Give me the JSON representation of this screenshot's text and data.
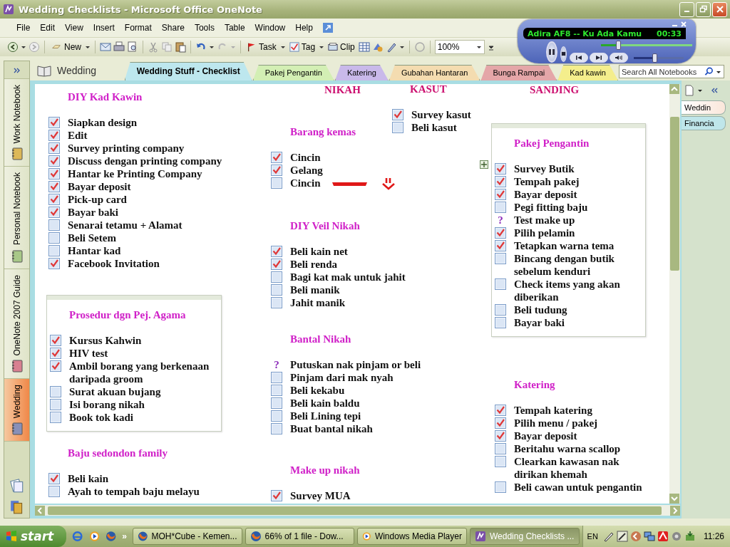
{
  "window": {
    "title": "Wedding Checklists - Microsoft Office OneNote"
  },
  "menu": [
    "File",
    "Edit",
    "View",
    "Insert",
    "Format",
    "Share",
    "Tools",
    "Table",
    "Window",
    "Help"
  ],
  "toolbar": {
    "new": "New",
    "task": "Task",
    "tag": "Tag",
    "clip": "Clip",
    "zoom": "100%"
  },
  "notebooks": [
    {
      "name": "Work Notebook",
      "color": "#dcb858",
      "selected": false
    },
    {
      "name": "Personal Notebook",
      "color": "#a8c888",
      "selected": false
    },
    {
      "name": "OneNote 2007 Guide",
      "color": "#d88090",
      "selected": false
    },
    {
      "name": "Wedding",
      "color": "#8890b8",
      "selected": true
    }
  ],
  "notebook_title": "Wedding",
  "sections": [
    {
      "label": "Wedding Stuff - Checklist",
      "color": "#bde7ee",
      "selected": true
    },
    {
      "label": "Pakej Pengantin",
      "color": "#d3efb4",
      "selected": false
    },
    {
      "label": "Katering",
      "color": "#c9b9ea",
      "selected": false
    },
    {
      "label": "Gubahan Hantaran",
      "color": "#f4dcb0",
      "selected": false
    },
    {
      "label": "Bunga Rampai",
      "color": "#e4a6a8",
      "selected": false
    },
    {
      "label": "Kad kawin",
      "color": "#f4ee8c",
      "selected": false
    }
  ],
  "search": {
    "placeholder": "Search All Notebooks"
  },
  "pages": [
    {
      "label": "Weddin",
      "selected": true
    },
    {
      "label": "Financia",
      "selected": false
    }
  ],
  "headings": [
    "NIKAH",
    "KASUT",
    "SANDING"
  ],
  "outlines": [
    {
      "title": "DIY Kad Kawin",
      "boxed": false,
      "items": [
        {
          "kind": "check",
          "text": "Siapkan design",
          "checked": true
        },
        {
          "kind": "check",
          "text": "Edit",
          "checked": true
        },
        {
          "kind": "check",
          "text": "Survey printing company",
          "checked": true
        },
        {
          "kind": "check",
          "text": "Discuss dengan printing company",
          "checked": true
        },
        {
          "kind": "check",
          "text": "Hantar ke Printing Company",
          "checked": true
        },
        {
          "kind": "check",
          "text": "Bayar deposit",
          "checked": true
        },
        {
          "kind": "check",
          "text": "Pick-up card",
          "checked": true
        },
        {
          "kind": "check",
          "text": "Bayar baki",
          "checked": true
        },
        {
          "kind": "check",
          "text": "Senarai tetamu + Alamat",
          "checked": false
        },
        {
          "kind": "check",
          "text": "Beli Setem",
          "checked": false
        },
        {
          "kind": "check",
          "text": "Hantar kad",
          "checked": false
        },
        {
          "kind": "check",
          "text": "Facebook Invitation",
          "checked": true
        }
      ]
    },
    {
      "title": "Prosedur dgn Pej. Agama",
      "boxed": true,
      "items": [
        {
          "kind": "check",
          "text": "Kursus Kahwin",
          "checked": true
        },
        {
          "kind": "check",
          "text": "HIV test",
          "checked": true
        },
        {
          "kind": "check",
          "text": "Ambil borang yang berkenaan daripada groom",
          "checked": true
        },
        {
          "kind": "check",
          "text": "Surat akuan bujang",
          "checked": false
        },
        {
          "kind": "check",
          "text": "Isi borang nikah",
          "checked": false
        },
        {
          "kind": "check",
          "text": "Book tok kadi",
          "checked": false
        }
      ]
    },
    {
      "title": "Baju sedondon family",
      "boxed": false,
      "items": [
        {
          "kind": "check",
          "text": "Beli kain",
          "checked": true
        },
        {
          "kind": "check",
          "text": "Ayah to tempah baju melayu",
          "checked": false
        }
      ]
    },
    {
      "title": "Barang kemas",
      "boxed": false,
      "items": [
        {
          "kind": "check",
          "text": "Cincin",
          "checked": true
        },
        {
          "kind": "check",
          "text": "Gelang",
          "checked": true
        },
        {
          "kind": "check",
          "text": "Cincin",
          "checked": false,
          "redacted": true
        }
      ]
    },
    {
      "title": "DIY Veil Nikah",
      "boxed": false,
      "items": [
        {
          "kind": "check",
          "text": "Beli kain net",
          "checked": true
        },
        {
          "kind": "check",
          "text": "Beli renda",
          "checked": true
        },
        {
          "kind": "check",
          "text": "Bagi kat mak untuk jahit",
          "checked": false
        },
        {
          "kind": "check",
          "text": "Beli manik",
          "checked": false
        },
        {
          "kind": "check",
          "text": "Jahit manik",
          "checked": false
        }
      ]
    },
    {
      "title": "Bantal Nikah",
      "boxed": false,
      "items": [
        {
          "kind": "question",
          "tag": "?",
          "text": "Putuskan nak pinjam or beli"
        },
        {
          "kind": "check",
          "text": "Pinjam dari mak nyah",
          "checked": false
        },
        {
          "kind": "check",
          "text": "Beli kekabu",
          "checked": false
        },
        {
          "kind": "check",
          "text": "Beli kain baldu",
          "checked": false
        },
        {
          "kind": "check",
          "text": "Beli Lining tepi",
          "checked": false
        },
        {
          "kind": "check",
          "text": "Buat bantal nikah",
          "checked": false
        }
      ]
    },
    {
      "title": "Make up nikah",
      "boxed": false,
      "items": [
        {
          "kind": "check",
          "text": "Survey MUA",
          "checked": true
        }
      ]
    },
    {
      "boxed": false,
      "items": [
        {
          "kind": "check",
          "text": "Survey kasut",
          "checked": true
        },
        {
          "kind": "check",
          "text": "Beli kasut",
          "checked": false
        }
      ]
    },
    {
      "title": "Pakej Pengantin",
      "boxed": true,
      "items": [
        {
          "kind": "check",
          "text": "Survey Butik",
          "checked": true
        },
        {
          "kind": "check",
          "text": "Tempah pakej",
          "checked": true
        },
        {
          "kind": "check",
          "text": "Bayar deposit",
          "checked": true
        },
        {
          "kind": "check",
          "text": "Pegi fitting baju",
          "checked": false
        },
        {
          "kind": "question",
          "tag": "?",
          "text": "Test make up"
        },
        {
          "kind": "check",
          "text": "Pilih pelamin",
          "checked": true
        },
        {
          "kind": "check",
          "text": "Tetapkan warna tema",
          "checked": true
        },
        {
          "kind": "check",
          "text": "Bincang dengan butik sebelum kenduri",
          "checked": false
        },
        {
          "kind": "check",
          "text": "Check items yang akan diberikan",
          "checked": false
        },
        {
          "kind": "check",
          "text": "Beli tudung",
          "checked": false
        },
        {
          "kind": "check",
          "text": "Bayar baki",
          "checked": false
        }
      ]
    },
    {
      "title": "Katering",
      "boxed": false,
      "items": [
        {
          "kind": "check",
          "text": "Tempah katering",
          "checked": true
        },
        {
          "kind": "check",
          "text": "Pilih menu / pakej",
          "checked": true
        },
        {
          "kind": "check",
          "text": "Bayar deposit",
          "checked": true
        },
        {
          "kind": "check",
          "text": "Beritahu warna scallop",
          "checked": false
        },
        {
          "kind": "check",
          "text": "Clearkan kawasan nak dirikan khemah",
          "checked": false
        },
        {
          "kind": "check",
          "text": "Beli cawan untuk pengantin",
          "checked": false
        }
      ]
    }
  ],
  "player": {
    "track": "Adira AF8 -- Ku Ada Kamu",
    "time": "00:33",
    "seek": {
      "level": 0.18
    },
    "volume": {
      "level": 0.4
    }
  },
  "taskbar": {
    "start": "start",
    "more": "»",
    "tasks": [
      {
        "kind": "browser",
        "label": "MOH*Cube - Kemen...",
        "selected": false
      },
      {
        "kind": "browser",
        "label": "66% of 1 file - Dow...",
        "selected": false
      },
      {
        "kind": "player",
        "label": "Windows Media Player",
        "selected": false
      },
      {
        "kind": "onenote",
        "label": "Wedding Checklists ...",
        "selected": true
      }
    ],
    "language": "EN",
    "clock": "11:26"
  }
}
